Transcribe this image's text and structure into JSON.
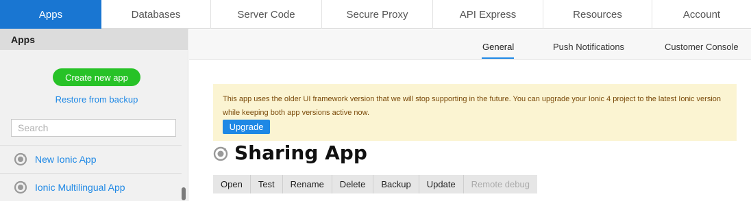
{
  "topnav": {
    "tabs": [
      {
        "label": "Apps",
        "active": true
      },
      {
        "label": "Databases"
      },
      {
        "label": "Server Code"
      },
      {
        "label": "Secure Proxy"
      },
      {
        "label": "API Express"
      },
      {
        "label": "Resources"
      },
      {
        "label": "Account"
      }
    ]
  },
  "sidebar": {
    "title": "Apps",
    "create_label": "Create new app",
    "restore_label": "Restore from backup",
    "search_placeholder": "Search",
    "apps": [
      {
        "label": "New Ionic App",
        "icon": "ionic-icon"
      },
      {
        "label": "Ionic Multilingual App",
        "icon": "ionic-icon"
      }
    ]
  },
  "subnav": {
    "tabs": [
      {
        "label": "General",
        "active": true
      },
      {
        "label": "Push Notifications"
      },
      {
        "label": "Customer Console"
      }
    ]
  },
  "notice": {
    "text": "This app uses the older UI framework version that we will stop supporting in the future. You can upgrade your Ionic 4 project to the latest Ionic version while keeping both app versions active now.",
    "button_label": "Upgrade"
  },
  "app": {
    "title": "Sharing App",
    "icon": "ionic-icon"
  },
  "actions": {
    "open": "Open",
    "test": "Test",
    "rename": "Rename",
    "delete": "Delete",
    "backup": "Backup",
    "update": "Update",
    "remote_debug": "Remote debug"
  },
  "colors": {
    "accent": "#1976d2",
    "link": "#1e88e5",
    "create_button": "#27c227",
    "notice_bg": "#fbf4d2"
  }
}
